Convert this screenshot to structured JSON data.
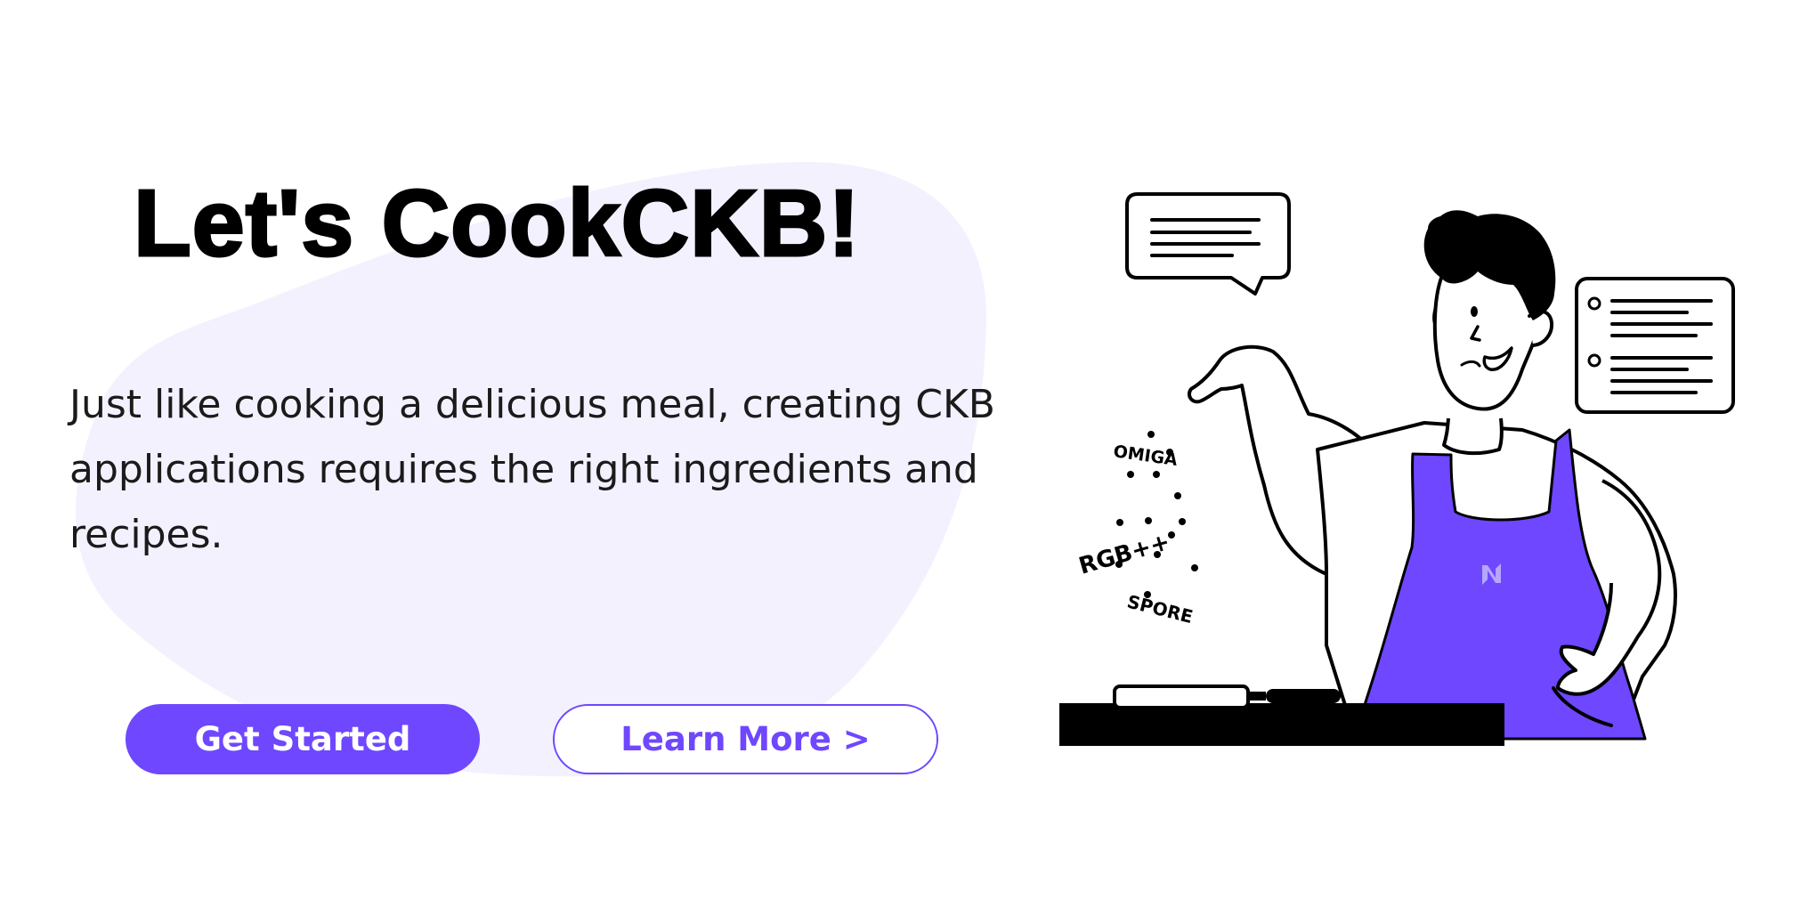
{
  "hero": {
    "title": "Let's CookCKB!",
    "subtitle": "Just like cooking a delicious meal, creating CKB applications requires the right ingredients and recipes."
  },
  "buttons": {
    "get_started": "Get Started",
    "learn_more": "Learn More >"
  },
  "illustration": {
    "ingredients": [
      "OMIGA",
      "RGB++",
      "SPORE"
    ],
    "icons": [
      "chef-illustration",
      "speech-bubble-icon",
      "recipe-card-icon",
      "frying-pan-icon",
      "apron-logo-icon"
    ]
  },
  "colors": {
    "accent": "#6e47ff",
    "blob": "#f4f1fe",
    "text": "#000000"
  }
}
